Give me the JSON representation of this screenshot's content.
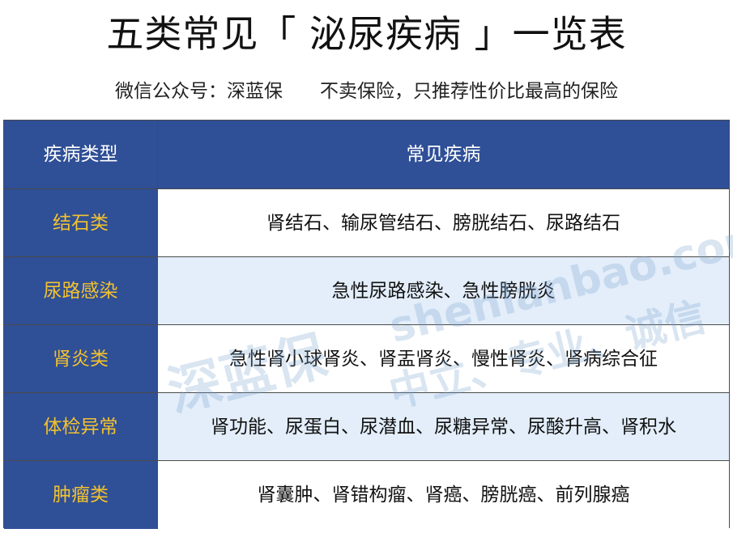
{
  "page": {
    "title": "五类常见「 泌尿疾病 」一览表",
    "subtitle_source": "微信公众号：深蓝保",
    "subtitle_slogan": "不卖保险，只推荐性价比最高的保险"
  },
  "table": {
    "headers": [
      "疾病类型",
      "常见疾病"
    ],
    "rows": [
      {
        "type": "结石类",
        "diseases": "肾结石、输尿管结石、膀胱结石、尿路结石"
      },
      {
        "type": "尿路感染",
        "diseases": "急性尿路感染、急性膀胱炎"
      },
      {
        "type": "肾炎类",
        "diseases": "急性肾小球肾炎、肾盂肾炎、慢性肾炎、肾病综合征"
      },
      {
        "type": "体检异常",
        "diseases": "肾功能、尿蛋白、尿潜血、尿糖异常、尿酸升高、肾积水"
      },
      {
        "type": "肿瘤类",
        "diseases": "肾囊肿、肾错构瘤、肾癌、膀胱癌、前列腺癌"
      }
    ]
  },
  "watermark": {
    "logo_text": "深蓝保",
    "url_text": "shenlanbao.com",
    "slogan_text": "中立、专业、诚信"
  },
  "colors": {
    "header_bg": "#2f4f96",
    "category_text": "#f3c22e",
    "row_alt_bg": "#e3eefa"
  }
}
